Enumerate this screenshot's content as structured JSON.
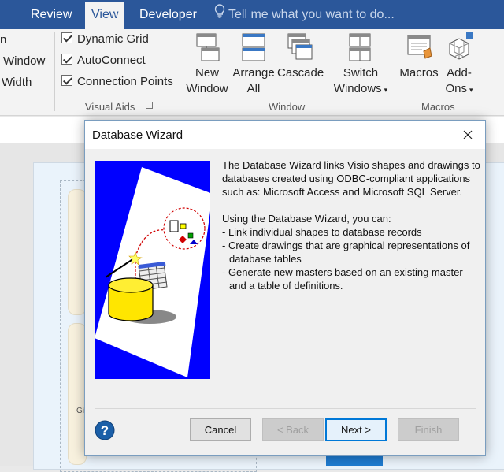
{
  "ribbon": {
    "tabs": [
      {
        "label": "Review",
        "active": false
      },
      {
        "label": "View",
        "active": true
      },
      {
        "label": "Developer",
        "active": false
      }
    ],
    "tell_me": "Tell me what you want to do...",
    "left_partial": [
      "n",
      "Window",
      "Width"
    ],
    "visual_aids": {
      "checks": [
        {
          "label": "Dynamic Grid",
          "checked": true
        },
        {
          "label": "AutoConnect",
          "checked": true
        },
        {
          "label": "Connection Points",
          "checked": true
        }
      ],
      "label": "Visual Aids"
    },
    "window_group": {
      "new_window": [
        "New",
        "Window"
      ],
      "arrange_all": [
        "Arrange",
        "All"
      ],
      "cascade": "Cascade",
      "switch_windows": [
        "Switch",
        "Windows"
      ],
      "label": "Window"
    },
    "macros_group": {
      "macros": "Macros",
      "addons": [
        "Add-",
        "Ons"
      ],
      "label": "Macros"
    }
  },
  "canvas": {
    "partial_label": "Gi"
  },
  "dialog": {
    "title": "Database Wizard",
    "description": "The Database Wizard links Visio shapes and drawings to databases created using ODBC-compliant applications such as: Microsoft Access and Microsoft SQL Server.",
    "intro": "Using the Database Wizard, you can:",
    "bullets": [
      "- Link individual shapes to database records",
      "- Create drawings that are graphical representations of database tables",
      "- Generate new masters based on an existing master and a table of definitions."
    ],
    "buttons": {
      "cancel": "Cancel",
      "back": "< Back",
      "next": "Next >",
      "finish": "Finish"
    }
  },
  "colors": {
    "ribbon_blue": "#2b579a",
    "illustration_blue": "#0000ff",
    "focus_blue": "#0078d7"
  }
}
